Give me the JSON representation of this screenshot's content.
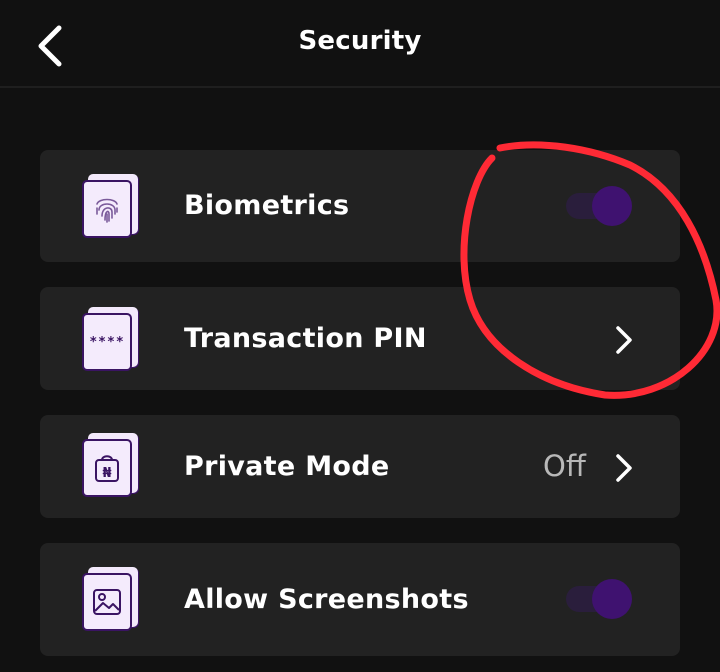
{
  "header": {
    "title": "Security",
    "back_icon": "chevron-left-icon"
  },
  "settings": [
    {
      "id": "biometrics",
      "label": "Biometrics",
      "icon": "fingerprint-icon",
      "control": "toggle",
      "enabled": true
    },
    {
      "id": "transaction-pin",
      "label": "Transaction PIN",
      "icon": "pin-icon",
      "icon_text": "****",
      "control": "chevron"
    },
    {
      "id": "private-mode",
      "label": "Private Mode",
      "icon": "wallet-naira-icon",
      "icon_text": "₦",
      "control": "chevron",
      "value": "Off"
    },
    {
      "id": "allow-screenshots",
      "label": "Allow Screenshots",
      "icon": "image-icon",
      "control": "toggle",
      "enabled": true
    }
  ],
  "colors": {
    "background": "#111111",
    "card": "#222222",
    "accent": "#3f1270",
    "icon_bg": "#f4ebfc",
    "annotation": "#ff2a35"
  }
}
